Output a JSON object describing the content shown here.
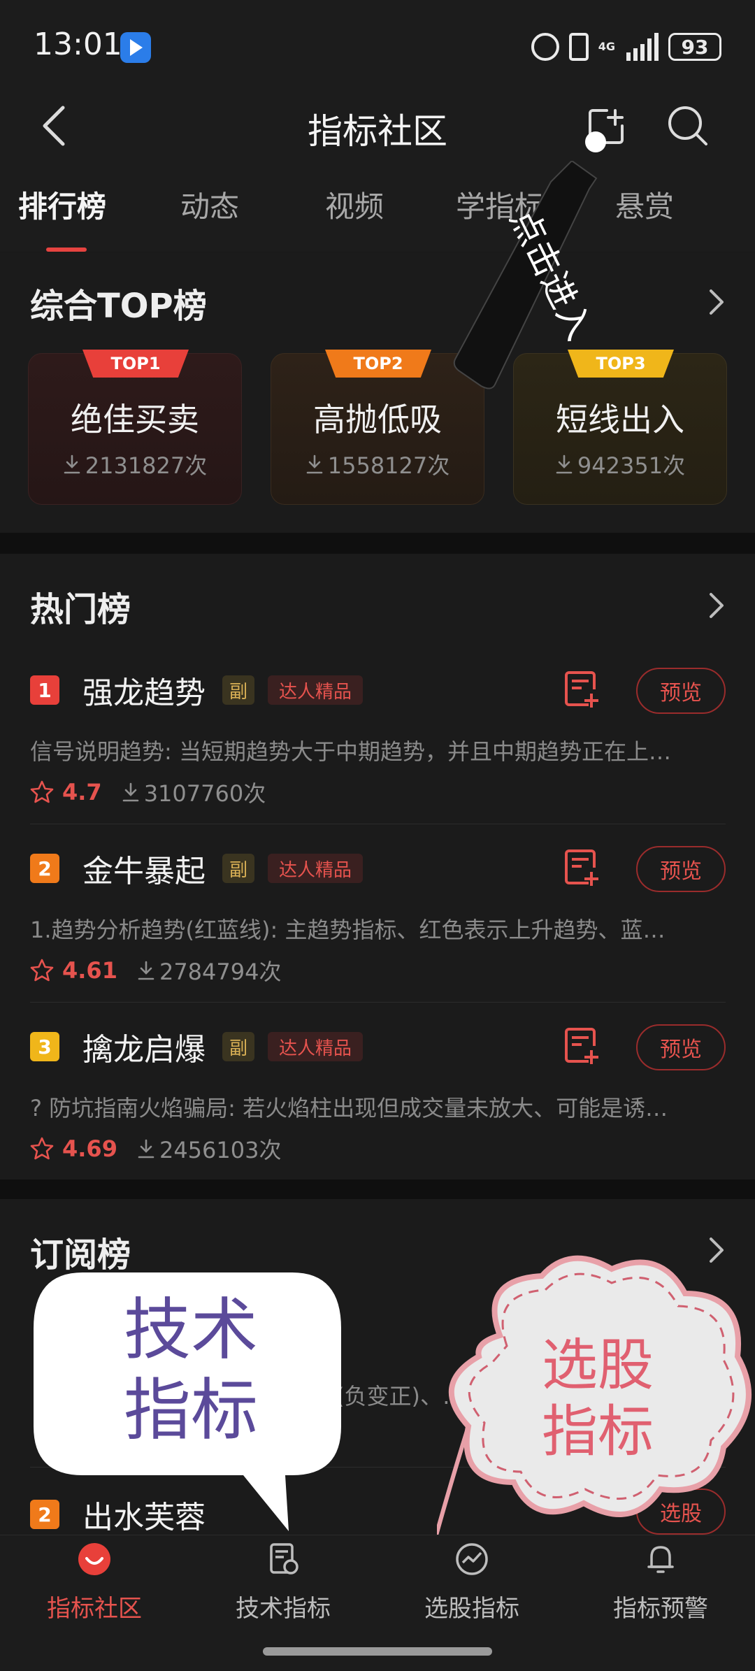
{
  "status": {
    "time": "13:01",
    "battery": "93",
    "network": "4G"
  },
  "header": {
    "title": "指标社区"
  },
  "tabs": [
    {
      "label": "排行榜"
    },
    {
      "label": "动态"
    },
    {
      "label": "视频"
    },
    {
      "label": "学指标"
    },
    {
      "label": "悬赏"
    }
  ],
  "tooltip": {
    "text": "点击进入"
  },
  "top_section": {
    "title": "综合TOP榜",
    "cards": [
      {
        "badge": "TOP1",
        "name": "绝佳买卖",
        "downloads": "2131827次",
        "badge_color": "#e8403a"
      },
      {
        "badge": "TOP2",
        "name": "高抛低吸",
        "downloads": "1558127次",
        "badge_color": "#f07a1a"
      },
      {
        "badge": "TOP3",
        "name": "短线出入",
        "downloads": "942351次",
        "badge_color": "#f0b61a"
      }
    ]
  },
  "hot_section": {
    "title": "热门榜",
    "tag_fu": "副",
    "tag_expert": "达人精品",
    "preview_label": "预览",
    "items": [
      {
        "rank": "1",
        "name": "强龙趋势",
        "desc": "信号说明趋势: 当短期趋势大于中期趋势，并且中期趋势正在上…",
        "rating": "4.7",
        "downloads": "3107760次",
        "rank_color": "#e8403a"
      },
      {
        "rank": "2",
        "name": "金牛暴起",
        "desc": "1.趋势分析趋势(红蓝线): 主趋势指标、红色表示上升趋势、蓝…",
        "rating": "4.61",
        "downloads": "2784794次",
        "rank_color": "#f07a1a"
      },
      {
        "rank": "3",
        "name": "擒龙启爆",
        "desc": "? 防坑指南火焰骗局: 若火焰柱出现但成交量未放大、可能是诱…",
        "rating": "4.69",
        "downloads": "2456103次",
        "rank_color": "#f0b61a"
      }
    ]
  },
  "sub_section": {
    "title": "订阅榜",
    "partial_desc": "(负变正)、…  信号…  DIF与DEA…",
    "item2_rank": "2",
    "item2_name": "出水芙蓉",
    "item2_button": "选股"
  },
  "overlays": {
    "bubble_left": {
      "line1": "技术",
      "line2": "指标"
    },
    "cloud_right": {
      "line1": "选股",
      "line2": "指标"
    }
  },
  "bottom_nav": [
    {
      "label": "指标社区",
      "icon": "community-icon"
    },
    {
      "label": "技术指标",
      "icon": "tech-indicator-icon"
    },
    {
      "label": "选股指标",
      "icon": "stock-pick-icon"
    },
    {
      "label": "指标预警",
      "icon": "bell-icon"
    }
  ]
}
